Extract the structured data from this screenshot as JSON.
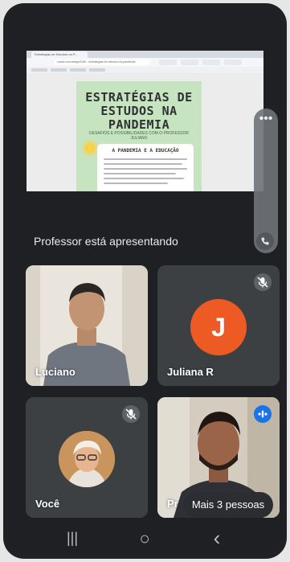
{
  "presentation": {
    "browser_tab": "Estratégias de Estudos na P...",
    "url": "canva.com/design/DAE.../estrategias-de-estudos-na-pandemia",
    "poster_title": "ESTRATÉGIAS DE ESTUDOS NA PANDEMIA",
    "poster_subtitle": "DESAFIOS E POSSIBILIDADES COM O PROFESSOR JULIANO",
    "box_title": "A PANDEMIA E A EDUCAÇÃO"
  },
  "presenting_text": "Professor está apresentando",
  "controls": {
    "more_icon": "more-horizontal-icon",
    "more_glyph": "•••",
    "call_icon": "phone-icon"
  },
  "participants": [
    {
      "name": "Luciano",
      "type": "video"
    },
    {
      "name": "Juliana R",
      "type": "avatar",
      "initial": "J",
      "avatar_color": "#ee5a24",
      "muted": true
    },
    {
      "name": "Você",
      "type": "photo",
      "muted": true
    },
    {
      "name": "Pr",
      "type": "video",
      "speaking": true
    }
  ],
  "more_people": "Mais 3 pessoas",
  "nav": {
    "recents_icon": "recent-apps-icon",
    "recents_glyph": "|||",
    "home_icon": "home-icon",
    "home_glyph": "○",
    "back_icon": "back-icon",
    "back_glyph": "‹"
  },
  "colors": {
    "accent": "#1a73e8",
    "avatar_j": "#ee5a24",
    "background": "#1f2023"
  }
}
